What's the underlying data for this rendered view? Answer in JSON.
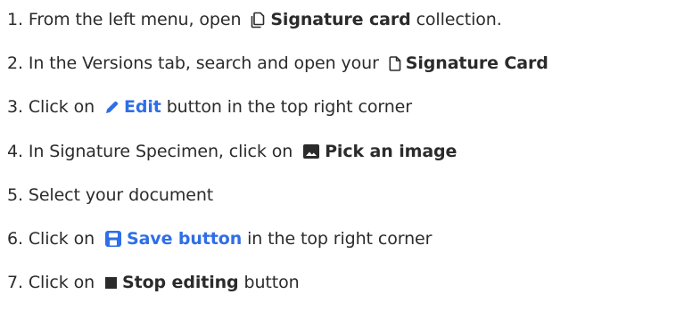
{
  "steps": [
    {
      "prefix": "1. From the left menu, open ",
      "icon": "collection-icon",
      "emph": "Signature card",
      "suffix": " collection."
    },
    {
      "prefix": "2. In the Versions tab, search and open your ",
      "icon": "document-icon",
      "emph": "Signature Card",
      "suffix": ""
    },
    {
      "prefix": "3. Click on ",
      "icon": "pencil-icon",
      "emph": "Edit",
      "suffix": " button in the top right corner"
    },
    {
      "prefix": "4. In Signature Specimen, click on ",
      "icon": "image-icon",
      "emph": "Pick an image",
      "suffix": ""
    },
    {
      "prefix": "5. Select your document",
      "suffix": ""
    },
    {
      "prefix": "6. Click on ",
      "icon": "save-icon",
      "emph": "Save button",
      "suffix": " in the top right corner"
    },
    {
      "prefix": "7. Click on ",
      "icon": "stop-icon",
      "emph": "Stop editing",
      "suffix": " button"
    }
  ],
  "colors": {
    "text": "#2b2b2b",
    "accent": "#2f6ee6"
  }
}
